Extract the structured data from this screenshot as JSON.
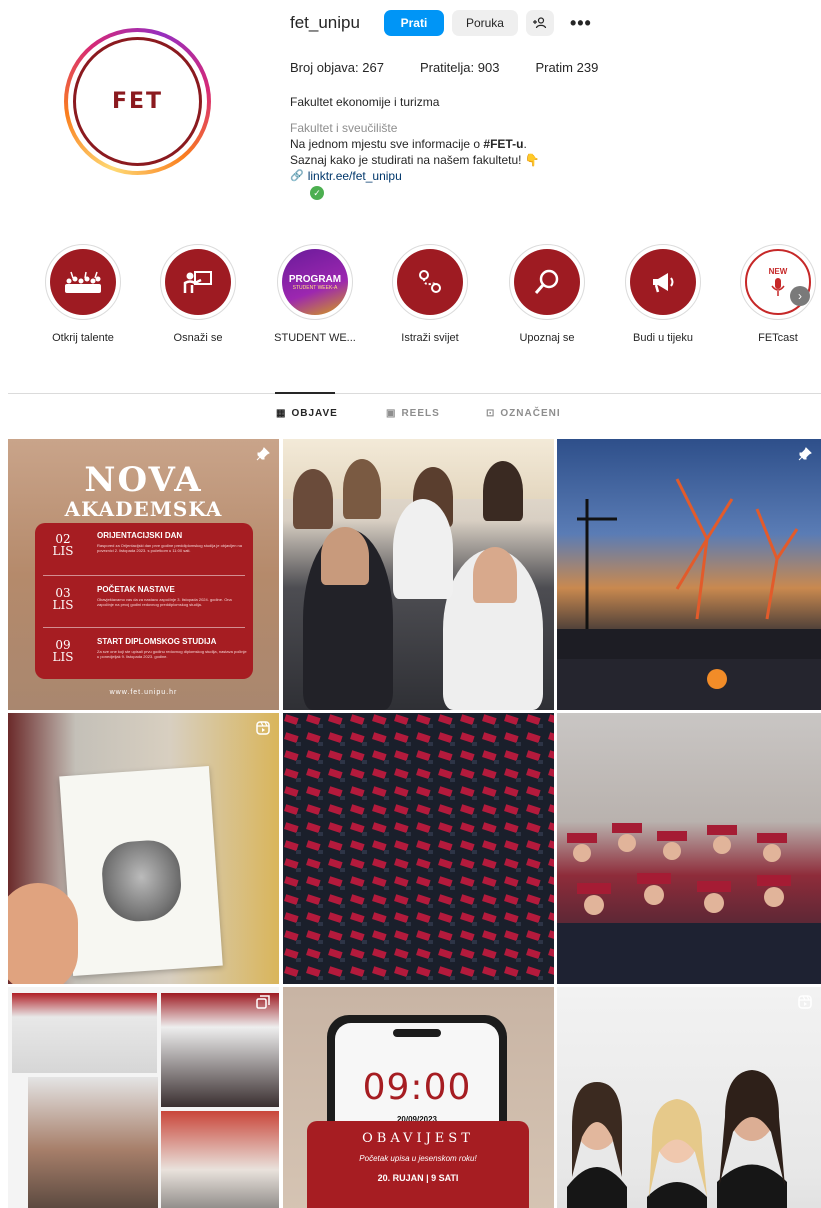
{
  "profile": {
    "username": "fet_unipu",
    "avatar_text": "FET",
    "follow_label": "Prati",
    "message_label": "Poruka",
    "suggest_icon": "+&",
    "more_icon": "•••",
    "stats": {
      "posts": "Broj objava: 267",
      "followers": "Pratitelja: 903",
      "following": "Pratim 239"
    },
    "bio": {
      "name": "Fakultet ekonomije i turizma",
      "category": "Fakultet i sveučilište",
      "line1_prefix": "Na jednom mjestu sve informacije o ",
      "line1_bold": "#FET-u",
      "line1_suffix": ".",
      "line2": "Saznaj kako je studirati na našem fakultetu! 👇",
      "link": "linktr.ee/fet_unipu",
      "link_icon": "🔗"
    }
  },
  "highlights": [
    {
      "label": "Otkrij talente",
      "icon": "crowd-icon"
    },
    {
      "label": "Osnaži se",
      "icon": "presenter-icon"
    },
    {
      "label": "STUDENT WE...",
      "icon": "program-poster-icon",
      "cover_text": "PROGRAM",
      "cover_sub": "STUDENT WEEK-A"
    },
    {
      "label": "Istraži svijet",
      "icon": "route-icon"
    },
    {
      "label": "Upoznaj se",
      "icon": "magnifier-icon"
    },
    {
      "label": "Budi u tijeku",
      "icon": "megaphone-icon"
    },
    {
      "label": "FETcast",
      "icon": "podcast-icon",
      "cover_text": "NEW"
    }
  ],
  "tabs": [
    {
      "label": "OBJAVE",
      "icon": "grid-icon",
      "active": true
    },
    {
      "label": "REELS",
      "icon": "reels-icon",
      "active": false
    },
    {
      "label": "OZNAČENI",
      "icon": "tagged-icon",
      "active": false
    }
  ],
  "posts": {
    "p1": {
      "title1": "NOVA",
      "title2": "AKADEMSKA",
      "rows": [
        {
          "day": "02",
          "month": "LIS",
          "head": "ORIJENTACIJSKI DAN",
          "text": "Raspored za Orijentacijski dan prve godine preddiplomskog studija je objavljen na poveznici 2. listopada 2023. s početkom u 11:00 sati."
        },
        {
          "day": "03",
          "month": "LIS",
          "head": "POČETAK NASTAVE",
          "text": "Obavještavamo vas da za nastavu započinje 3. listopada 2024. godine. Ona započinje na prvoj godini redovnog preddiplomskog studija."
        },
        {
          "day": "09",
          "month": "LIS",
          "head": "START DIPLOMSKOG STUDIJA",
          "text": "Za sve one koji ste upisali prvu godinu redovnog diplomskog studija, nastava počinje u ponedjeljak 9. listopada 2023. godine."
        }
      ],
      "url": "www.fet.unipu.hr",
      "badge": "pin-icon"
    },
    "p3": {
      "badge": "pin-icon"
    },
    "p4": {
      "badge": "reel-icon"
    },
    "p7": {
      "badge": "carousel-icon"
    },
    "p8": {
      "time": "09:00",
      "date": "20/09/2023",
      "heading": "OBAVIJEST",
      "line1": "Početak upisa u jesenskom roku!",
      "line2": "20. RUJAN | 9 SATI"
    },
    "p9": {
      "badge": "reel-icon"
    }
  },
  "colors": {
    "accent_blue": "#0095f6",
    "fet_red": "#a61d22"
  }
}
